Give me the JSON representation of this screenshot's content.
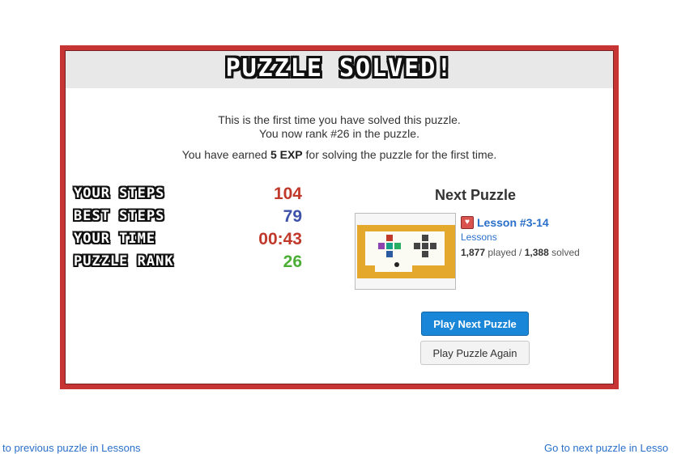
{
  "modal": {
    "title": "PUZZLE SOLVED!",
    "line1": "This is the first time you have solved this puzzle.",
    "line2": "You now rank #26 in the puzzle.",
    "earned_prefix": "You have earned ",
    "earned_exp": "5 EXP",
    "earned_suffix": " for solving the puzzle for the first time."
  },
  "stats": [
    {
      "label": "YOUR STEPS",
      "value": "104",
      "color": "#c0392b"
    },
    {
      "label": "BEST STEPS",
      "value": "79",
      "color": "#3d52a8"
    },
    {
      "label": "YOUR TIME",
      "value": "00:43",
      "color": "#c0392b"
    },
    {
      "label": "PUZZLE RANK",
      "value": "26",
      "color": "#4caf35"
    }
  ],
  "next_puzzle": {
    "heading": "Next Puzzle",
    "lesson": "Lesson #3-14",
    "collection": "Lessons",
    "played": "1,877",
    "played_label": " played / ",
    "solved": "1,388",
    "solved_label": " solved",
    "play_next_button": "Play Next Puzzle",
    "play_again_button": "Play Puzzle Again"
  },
  "footer": {
    "prev_link": "to previous puzzle in Lessons",
    "next_link": "Go to next puzzle in Lesso"
  },
  "colors": {
    "frame": "#c73434",
    "accent": "#1a86d8"
  }
}
